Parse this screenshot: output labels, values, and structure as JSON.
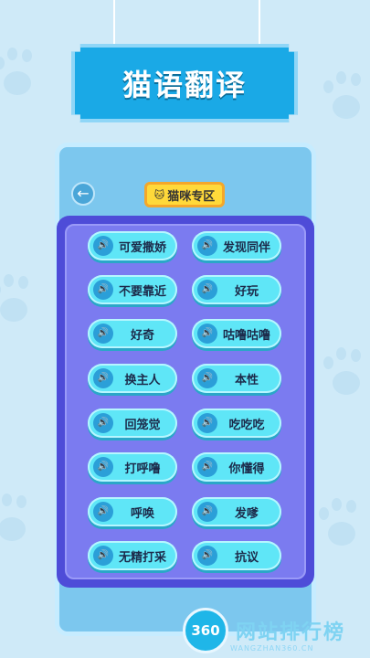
{
  "app": {
    "title": "猫语翻译"
  },
  "header": {
    "back_icon": "←",
    "zone_icon": "🐱",
    "zone_label": "猫咪专区"
  },
  "phrases": [
    "可爱撒娇",
    "发现同伴",
    "不要靠近",
    "好玩",
    "好奇",
    "咕噜咕噜",
    "换主人",
    "本性",
    "回笼觉",
    "吃吃吃",
    "打呼噜",
    "你懂得",
    "呼唤",
    "发嗲",
    "无精打采",
    "抗议"
  ],
  "speaker_icon": "🔊",
  "watermark": {
    "badge": "360",
    "text": "网站排行榜",
    "domain": "WANGZHAN360.CN"
  },
  "colors": {
    "background": "#cfeaf8",
    "banner": "#1aa9e6",
    "panel": "#4e4cd8",
    "button": "#5fe6f7",
    "tag": "#ffd93a"
  }
}
